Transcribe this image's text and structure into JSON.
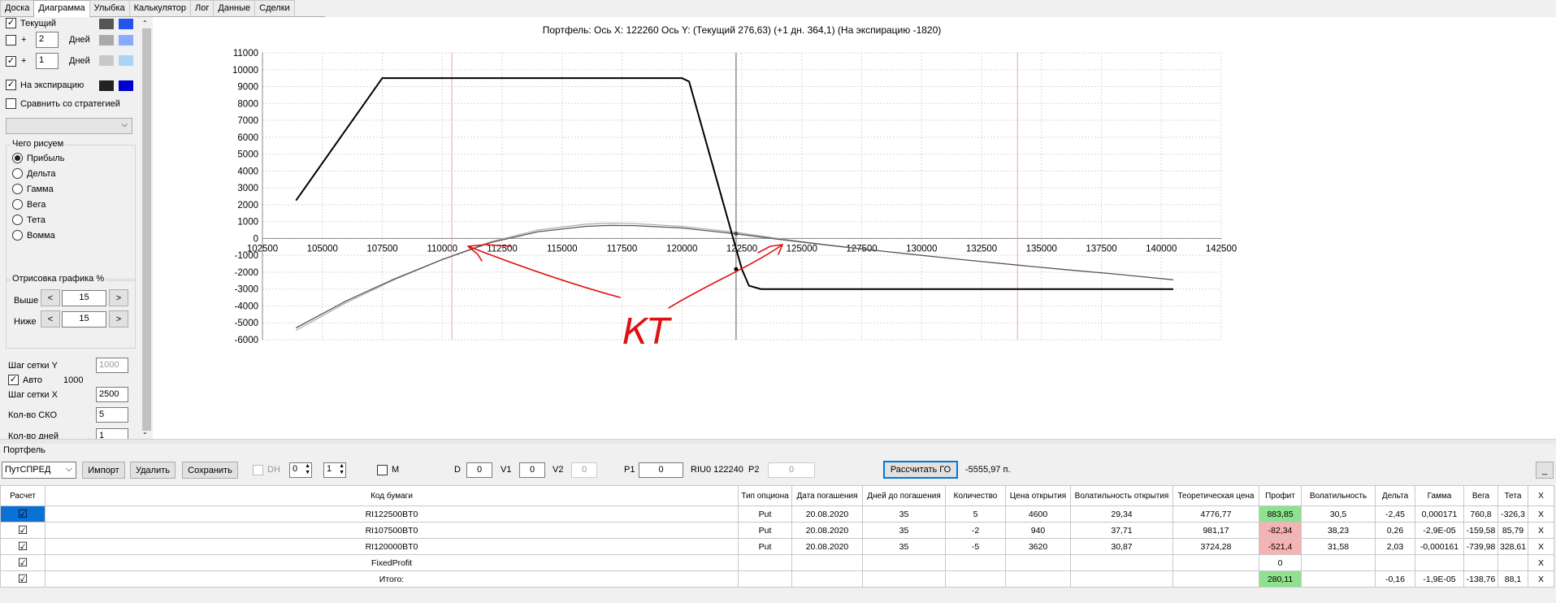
{
  "tabs": [
    "Доска",
    "Диаграмма",
    "Улыбка",
    "Калькулятор",
    "Лог",
    "Данные",
    "Сделки"
  ],
  "active_tab": "Диаграмма",
  "left": {
    "current": {
      "label": "Текущий",
      "checked": true,
      "c1": "#555555",
      "c2": "#2255ee"
    },
    "plus1": {
      "sign": "+",
      "value": "2",
      "unit": "Дней",
      "checked": false,
      "c1": "#aaaaaa",
      "c2": "#88aaff"
    },
    "plus2": {
      "sign": "+",
      "value": "1",
      "unit": "Дней",
      "checked": true,
      "c1": "#c8c8c8",
      "c2": "#aad4f5"
    },
    "expiry": {
      "label": "На экспирацию",
      "checked": true,
      "c1": "#222222",
      "c2": "#0000cc"
    },
    "compare": {
      "label": "Сравнить со стратегией",
      "checked": false
    },
    "draw_group": "Чего рисуем",
    "radios": [
      "Прибыль",
      "Дельта",
      "Гамма",
      "Вега",
      "Тета",
      "Вомма"
    ],
    "radio_selected": 0,
    "render_group": "Отрисовка графика %",
    "above_label": "Выше",
    "above_value": "15",
    "below_label": "Ниже",
    "below_value": "15",
    "left_arrow": "<",
    "right_arrow": ">",
    "grid_y_label": "Шаг сетки Y",
    "grid_y_value": "1000",
    "auto_label": "Авто",
    "auto_value": "1000",
    "auto_checked": true,
    "grid_x_label": "Шаг сетки X",
    "grid_x_value": "2500",
    "sko_label": "Кол-во СКО",
    "sko_value": "5",
    "days_label": "Кол-во дней",
    "days_value": "1"
  },
  "chart_data": {
    "type": "line",
    "title": "Портфель:  Ось X:  122260  Ось Y:   (Текущий 276,63)   (+1 дн.  364,1)   (На экспирацию -1820)",
    "xlim": [
      102500,
      142500
    ],
    "ylim": [
      -6000,
      11000
    ],
    "x_ticks": [
      102500,
      105000,
      107500,
      110000,
      112500,
      115000,
      117500,
      120000,
      122500,
      125000,
      127500,
      130000,
      132500,
      135000,
      137500,
      140000,
      142500
    ],
    "y_ticks": [
      11000,
      10000,
      9000,
      8000,
      7000,
      6000,
      5000,
      4000,
      3000,
      2000,
      1000,
      0,
      -1000,
      -2000,
      -3000,
      -4000,
      -5000,
      -6000
    ],
    "grid": true,
    "cursor_x": 122260,
    "sigma_lines": [
      110400,
      134000
    ],
    "series": [
      {
        "color": "#000000",
        "points": [
          [
            103900,
            2250
          ],
          [
            107500,
            9500
          ],
          [
            120000,
            9500
          ],
          [
            120300,
            9300
          ],
          [
            122500,
            -1820
          ],
          [
            122800,
            -2800
          ],
          [
            123300,
            -3000
          ],
          [
            140500,
            -3000
          ]
        ]
      },
      {
        "color": "#555555",
        "points": [
          [
            103900,
            -5300
          ],
          [
            106000,
            -3700
          ],
          [
            108000,
            -2400
          ],
          [
            110000,
            -1250
          ],
          [
            112000,
            -250
          ],
          [
            114000,
            400
          ],
          [
            116000,
            720
          ],
          [
            117000,
            770
          ],
          [
            118000,
            760
          ],
          [
            120000,
            620
          ],
          [
            122260,
            277
          ],
          [
            124000,
            -50
          ],
          [
            126000,
            -380
          ],
          [
            128000,
            -700
          ],
          [
            130000,
            -1000
          ],
          [
            132000,
            -1300
          ],
          [
            134000,
            -1580
          ],
          [
            136000,
            -1850
          ],
          [
            138000,
            -2100
          ],
          [
            140500,
            -2450
          ]
        ]
      },
      {
        "color": "#b0b0b0",
        "points": [
          [
            103900,
            -5450
          ],
          [
            106000,
            -3800
          ],
          [
            108000,
            -2450
          ],
          [
            110000,
            -1250
          ],
          [
            112000,
            -200
          ],
          [
            114000,
            500
          ],
          [
            116000,
            850
          ],
          [
            117000,
            900
          ],
          [
            118000,
            880
          ],
          [
            120000,
            720
          ],
          [
            122260,
            364
          ],
          [
            124000,
            0
          ],
          [
            126000,
            -380
          ],
          [
            128000,
            -720
          ]
        ]
      }
    ],
    "annotation": "КТ"
  },
  "portfolio_label": "Портфель",
  "toolbar": {
    "strategy": "ПутСПРЕД",
    "import": "Импорт",
    "delete": "Удалить",
    "save": "Сохранить",
    "dh": "DH",
    "dh_val1": "0",
    "dh_val2": "1",
    "m": "M",
    "d_label": "D",
    "d_val": "0",
    "v1_label": "V1",
    "v1_val": "0",
    "v2_label": "V2",
    "v2_val": "0",
    "p1_label": "P1",
    "p1_val": "0",
    "riu": "RIU0 122240",
    "p2_label": "P2",
    "p2_val": "0",
    "calc": "Рассчитать ГО",
    "go": "-5555,97 п.",
    "min": "_"
  },
  "table": {
    "headers": [
      "Расчет",
      "Код бумаги",
      "Тип опциона",
      "Дата погашения",
      "Дней до погашения",
      "Количество",
      "Цена открытия",
      "Волатильность открытия",
      "Теоретическая цена",
      "Профит",
      "Волатильность",
      "Дельта",
      "Гамма",
      "Вега",
      "Тета",
      "X"
    ],
    "rows": [
      [
        "☑",
        "RI122500BT0",
        "Put",
        "20.08.2020",
        "35",
        "5",
        "4600",
        "29,34",
        "4776,77",
        "883,85",
        "30,5",
        "-2,45",
        "0,000171",
        "760,8",
        "-326,3",
        "X"
      ],
      [
        "☑",
        "RI107500BT0",
        "Put",
        "20.08.2020",
        "35",
        "-2",
        "940",
        "37,71",
        "981,17",
        "-82,34",
        "38,23",
        "0,26",
        "-2,9E-05",
        "-159,58",
        "85,79",
        "X"
      ],
      [
        "☑",
        "RI120000BT0",
        "Put",
        "20.08.2020",
        "35",
        "-5",
        "3620",
        "30,87",
        "3724,28",
        "-521,4",
        "31,58",
        "2,03",
        "-0,000161",
        "-739,98",
        "328,61",
        "X"
      ],
      [
        "☑",
        "FixedProfit",
        "",
        "",
        "",
        "",
        "",
        "",
        "",
        "0",
        "",
        "",
        "",
        "",
        "",
        "X"
      ],
      [
        "☑",
        "Итого:",
        "",
        "",
        "",
        "",
        "",
        "",
        "",
        "280,11",
        "",
        "-0,16",
        "-1,9E-05",
        "-138,76",
        "88,1",
        "X"
      ]
    ],
    "profit_colors": [
      "g",
      "r",
      "r",
      "",
      "g"
    ]
  }
}
